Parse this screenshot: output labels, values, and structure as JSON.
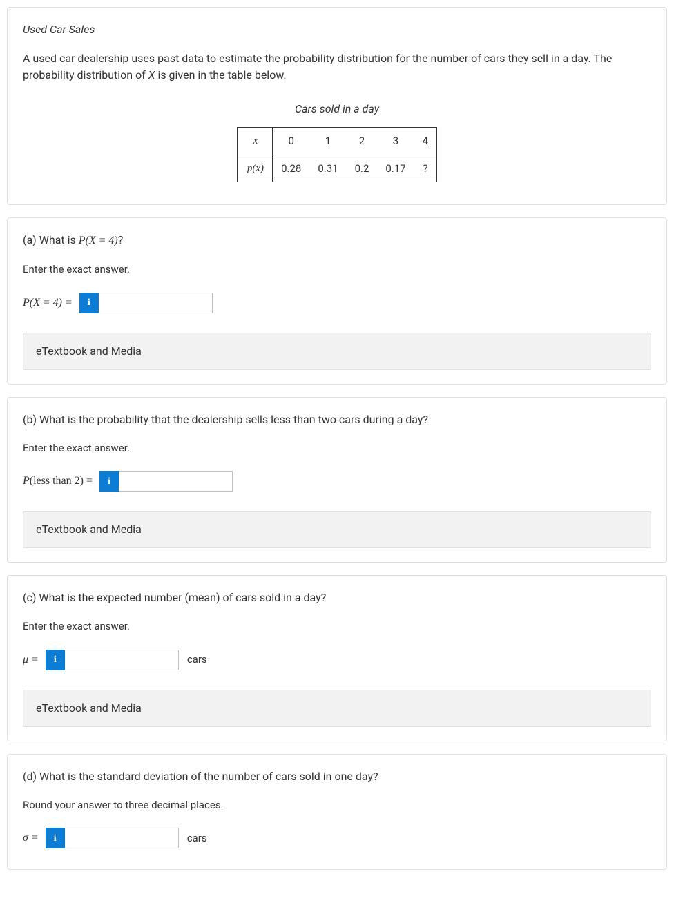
{
  "intro": {
    "title": "Used Car Sales",
    "description_prefix": "A used car dealership uses past data to estimate the probability distribution for the number of cars they sell in a day. The probability distribution of ",
    "description_var": "X",
    "description_suffix": " is given in the table below.",
    "table_caption": "Cars sold in a day",
    "table": {
      "header_row_label": "x",
      "header_values": [
        "0",
        "1",
        "2",
        "3",
        "4"
      ],
      "prob_row_label": "p(x)",
      "prob_values": [
        "0.28",
        "0.31",
        "0.2",
        "0.17",
        "?"
      ]
    }
  },
  "part_a": {
    "question_prefix": "(a) What is ",
    "question_math": "P(X = 4)",
    "question_suffix": "?",
    "instruction": "Enter the exact answer.",
    "label_math": "P(X = 4) =",
    "etextbook": "eTextbook and Media"
  },
  "part_b": {
    "question": "(b) What is the probability that the dealership sells less than two cars during a day?",
    "instruction": "Enter the exact answer.",
    "label_math_prefix": "P",
    "label_math_paren": "(less than 2) =",
    "etextbook": "eTextbook and Media"
  },
  "part_c": {
    "question": "(c) What is the expected number (mean) of cars sold in a day?",
    "instruction": "Enter the exact answer.",
    "label_math": "μ =",
    "unit": "cars",
    "etextbook": "eTextbook and Media"
  },
  "part_d": {
    "question": "(d) What is the standard deviation of the number of cars sold in one day?",
    "instruction": "Round your answer to three decimal places.",
    "label_math": "σ =",
    "unit": "cars"
  },
  "info_glyph": "i"
}
